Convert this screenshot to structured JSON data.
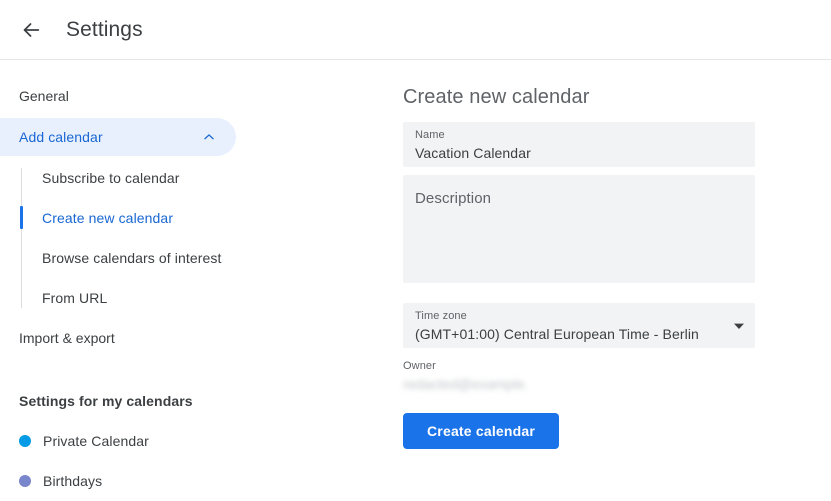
{
  "header": {
    "back_icon": "arrow-left-icon",
    "title": "Settings"
  },
  "sidebar": {
    "general_label": "General",
    "add_calendar": {
      "label": "Add calendar",
      "expanded_icon": "chevron-up-icon",
      "items": [
        {
          "label": "Subscribe to calendar",
          "active": false
        },
        {
          "label": "Create new calendar",
          "active": true
        },
        {
          "label": "Browse calendars of interest",
          "active": false
        },
        {
          "label": "From URL",
          "active": false
        }
      ]
    },
    "import_export_label": "Import & export",
    "my_calendars_heading": "Settings for my calendars",
    "calendars": [
      {
        "label": "Private Calendar",
        "color": "#039be5"
      },
      {
        "label": "Birthdays",
        "color": "#7986cb"
      }
    ],
    "accent_color": "#1a73e8",
    "active_pill_bg": "#e8f0fe",
    "active_text_color": "#1967d2"
  },
  "main": {
    "page_title": "Create new calendar",
    "name_field": {
      "label": "Name",
      "value": "Vacation Calendar"
    },
    "description_field": {
      "placeholder": "Description",
      "value": ""
    },
    "timezone_field": {
      "label": "Time zone",
      "value": "(GMT+01:00) Central European Time - Berlin",
      "caret_icon": "triangle-down-icon"
    },
    "owner_field": {
      "label": "Owner",
      "value": "redacted@example.com"
    },
    "create_button": {
      "label": "Create calendar",
      "color": "#1a73e8"
    }
  }
}
